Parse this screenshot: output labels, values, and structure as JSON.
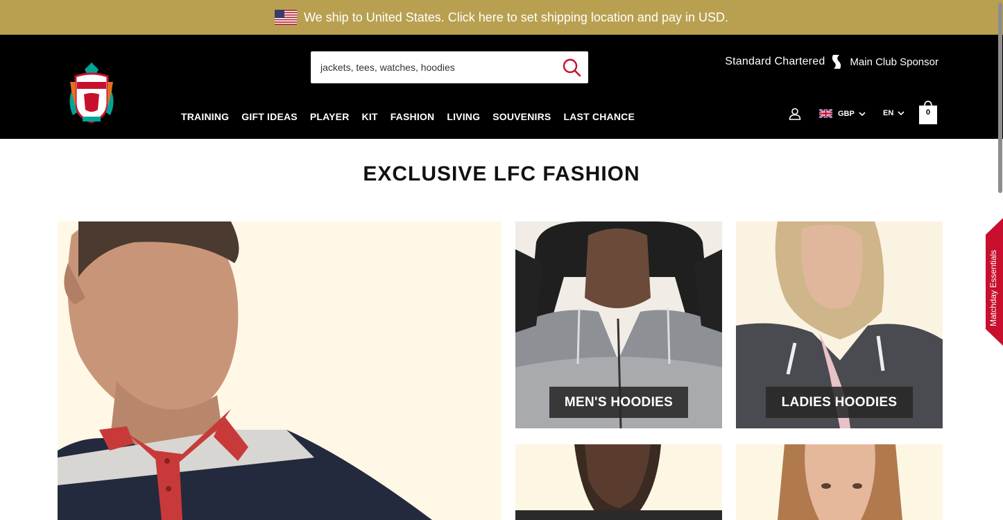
{
  "shipping_bar": {
    "message": "We ship to United States. Click here to set shipping location and pay in USD.",
    "flag_icon": "us-flag-icon"
  },
  "header": {
    "search": {
      "placeholder": "jackets, tees, watches, hoodies",
      "icon": "search-icon"
    },
    "sponsor": {
      "brand": "Standard Chartered",
      "tagline": "Main Club Sponsor"
    },
    "nav": [
      "TRAINING",
      "GIFT IDEAS",
      "PLAYER",
      "KIT",
      "FASHION",
      "LIVING",
      "SOUVENIRS",
      "LAST CHANCE"
    ],
    "currency": "GBP",
    "language": "EN",
    "bag_count": "0"
  },
  "main": {
    "title": "EXCLUSIVE LFC FASHION",
    "tiles": [
      {
        "label": "MEN'S HOODIES"
      },
      {
        "label": "LADIES HOODIES"
      }
    ]
  },
  "side_tab": {
    "label": "Matchday Essentials"
  },
  "colors": {
    "ship_bar": "#b9a050",
    "header_bg": "#000000",
    "accent_red": "#c8102e",
    "tile_bg": "#fdf6e3"
  }
}
